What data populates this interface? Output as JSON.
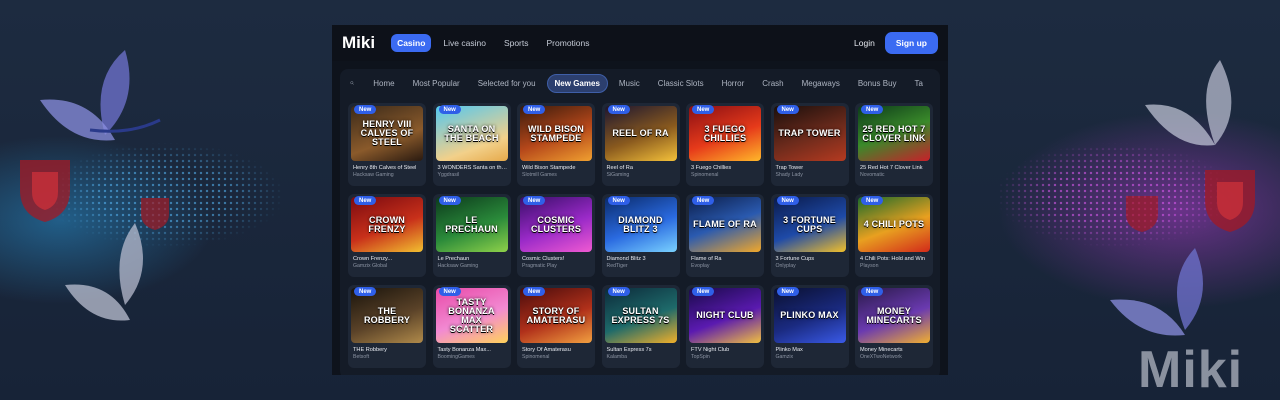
{
  "brand": "Miki",
  "topnav": [
    {
      "label": "Casino",
      "active": true
    },
    {
      "label": "Live casino",
      "active": false
    },
    {
      "label": "Sports",
      "active": false
    },
    {
      "label": "Promotions",
      "active": false
    }
  ],
  "auth": {
    "login": "Login",
    "signup": "Sign up"
  },
  "categories": [
    {
      "label": "Home",
      "active": false
    },
    {
      "label": "Most Popular",
      "active": false
    },
    {
      "label": "Selected for you",
      "active": false
    },
    {
      "label": "New Games",
      "active": true
    },
    {
      "label": "Music",
      "active": false
    },
    {
      "label": "Classic Slots",
      "active": false
    },
    {
      "label": "Horror",
      "active": false
    },
    {
      "label": "Crash",
      "active": false
    },
    {
      "label": "Megaways",
      "active": false
    },
    {
      "label": "Bonus Buy",
      "active": false
    },
    {
      "label": "Ta",
      "active": false
    }
  ],
  "badge_label": "New",
  "games": [
    {
      "name": "Henry 8th Calves of Steel",
      "provider": "Hacksaw Gaming",
      "art": "HENRY VIII CALVES OF STEEL",
      "bg": "linear-gradient(160deg,#3b2a1a,#8a5a2b 60%,#2a1a10)"
    },
    {
      "name": "3 WONDERS Santa on the...",
      "provider": "Yggdrasil",
      "art": "SANTA ON THE BEACH",
      "bg": "linear-gradient(160deg,#52c7f0,#f2d08a 70%,#e6a94a)"
    },
    {
      "name": "Wild Bison Stampede",
      "provider": "Slotmill Games",
      "art": "WILD BISON STAMPEDE",
      "bg": "linear-gradient(160deg,#3a1b0c,#b5471a 55%,#f0a030)"
    },
    {
      "name": "Reel of Ra",
      "provider": "SiGaming",
      "art": "REEL OF RA",
      "bg": "linear-gradient(160deg,#1c1530,#8a5a1e 55%,#f5c23a)"
    },
    {
      "name": "3 Fuego Chillies",
      "provider": "Spinomenal",
      "art": "3 FUEGO CHILLIES",
      "bg": "linear-gradient(160deg,#8a0f14,#e63a1a 55%,#ffb82a)"
    },
    {
      "name": "Trap Tower",
      "provider": "Shady Lady",
      "art": "TRAP TOWER",
      "bg": "linear-gradient(160deg,#1a0f0c,#6e2b1c 55%,#b53a20)"
    },
    {
      "name": "25 Red Hot 7 Clover Link",
      "provider": "Novomatic",
      "art": "25 RED HOT 7 CLOVER LINK",
      "bg": "linear-gradient(160deg,#0c3a1a,#3a8a2a 50%,#c8202a)"
    },
    {
      "name": "Crown Frenzy...",
      "provider": "Gamzix Global",
      "art": "CROWN FRENZY",
      "bg": "linear-gradient(160deg,#7a0a10,#c8301a 55%,#f2c030)"
    },
    {
      "name": "Le Prechaun",
      "provider": "Hacksaw Gaming",
      "art": "LE PRECHAUN",
      "bg": "linear-gradient(160deg,#0c3a1c,#2a8a3a 55%,#8fd24a)"
    },
    {
      "name": "Cosmic Clusters!",
      "provider": "Pragmatic Play",
      "art": "COSMIC CLUSTERS",
      "bg": "linear-gradient(160deg,#3a0e6a,#9a2ac8 55%,#f05ad2)"
    },
    {
      "name": "Diamond Blitz 3",
      "provider": "RedTiger",
      "art": "DIAMOND BLITZ 3",
      "bg": "linear-gradient(160deg,#0a2a6a,#2a6ae0 55%,#7ad2ff)"
    },
    {
      "name": "Flame of Ra",
      "provider": "Evoplay",
      "art": "FLAME OF RA",
      "bg": "linear-gradient(160deg,#0c1e4a,#2a5ab0 50%,#f2a82a)"
    },
    {
      "name": "3 Fortune Cups",
      "provider": "Onlyplay",
      "art": "3 FORTUNE CUPS",
      "bg": "linear-gradient(160deg,#0a1a4a,#1e4aa8 55%,#f2c02a)"
    },
    {
      "name": "4 Chili Pots: Hold and Win",
      "provider": "Playson",
      "art": "4 CHILI POTS",
      "bg": "linear-gradient(160deg,#1a6a2a,#e8a020 55%,#d22a1a)"
    },
    {
      "name": "THE Robbery",
      "provider": "Betsoft",
      "art": "THE ROBBERY",
      "bg": "linear-gradient(160deg,#1a140c,#5a4228 55%,#b08a4a)"
    },
    {
      "name": "Tasty Bonanza Max...",
      "provider": "BoomingGames",
      "art": "TASTY BONANZA MAX SCATTER",
      "bg": "linear-gradient(160deg,#e84aa8,#f28ad2 55%,#ffd25a)"
    },
    {
      "name": "Story Of Amaterasu",
      "provider": "Spinomenal",
      "art": "STORY OF AMATERASU",
      "bg": "linear-gradient(160deg,#4a0c0c,#b0301a 55%,#f2a040)"
    },
    {
      "name": "Sultan Express 7s",
      "provider": "Kalamba",
      "art": "SULTAN EXPRESS 7s",
      "bg": "linear-gradient(160deg,#0c2a3a,#1e6a6a 55%,#f2b02a)"
    },
    {
      "name": "FTV Night Club",
      "provider": "TopSpin",
      "art": "NIGHT CLUB",
      "bg": "linear-gradient(160deg,#1a0a4a,#5a1ab0 55%,#f2c040)"
    },
    {
      "name": "Plinko Max",
      "provider": "Gamzix",
      "art": "PLINKO MAX",
      "bg": "linear-gradient(160deg,#0a1030,#1a2a80 55%,#3a5ae8)"
    },
    {
      "name": "Money Minecarts",
      "provider": "OneXTwoNetwork",
      "art": "MONEY MINECARTS",
      "bg": "linear-gradient(160deg,#2a1a4a,#6a3ab0 55%,#f2b030)"
    }
  ]
}
